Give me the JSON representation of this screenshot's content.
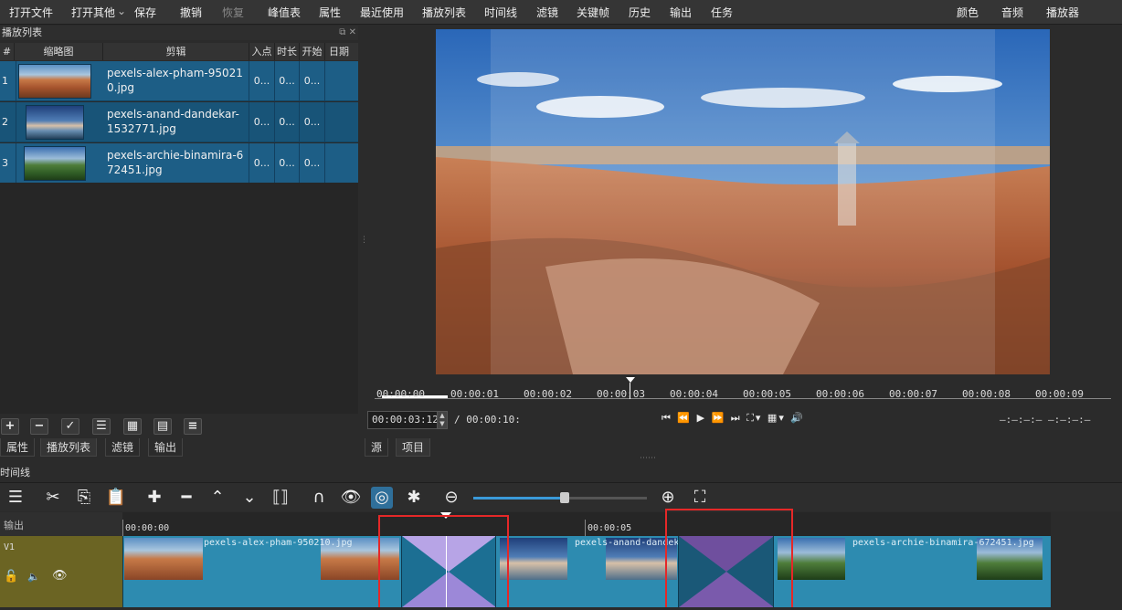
{
  "toolbar": {
    "items": [
      "打开文件",
      "打开其他",
      "保存",
      "撤销",
      "恢复",
      "峰值表",
      "属性",
      "最近使用",
      "播放列表",
      "时间线",
      "滤镜",
      "关键帧",
      "历史",
      "输出",
      "任务"
    ],
    "right_items": [
      "颜色",
      "音频",
      "播放器"
    ]
  },
  "playlist": {
    "title": "播放列表",
    "columns": [
      "#",
      "缩略图",
      "剪辑",
      "入点",
      "时长",
      "开始",
      "日期"
    ],
    "rows": [
      {
        "num": "1",
        "name": "pexels-alex-pham-950210.jpg",
        "in": "0...",
        "dur": "0...",
        "start": "0..."
      },
      {
        "num": "2",
        "name": "pexels-anand-dandekar-1532771.jpg",
        "in": "0...",
        "dur": "0...",
        "start": "0..."
      },
      {
        "num": "3",
        "name": "pexels-archie-binamira-672451.jpg",
        "in": "0...",
        "dur": "0...",
        "start": "0..."
      }
    ],
    "buttons": [
      "+",
      "−",
      "✓",
      "☰",
      "▦",
      "▤",
      "≡"
    ],
    "tabs": [
      "属性",
      "播放列表",
      "滤镜",
      "输出"
    ]
  },
  "viewer": {
    "ruler_ticks": [
      "00:00:00",
      "00:00:01",
      "00:00:02",
      "00:00:03",
      "00:00:04",
      "00:00:05",
      "00:00:06",
      "00:00:07",
      "00:00:08",
      "00:00:09"
    ],
    "timecode": "00:00:03:12",
    "duration": "/ 00:00:10:",
    "right_readout": "—:—:—:— —:—:—:—",
    "tabs": [
      "源",
      "项目"
    ]
  },
  "timeline": {
    "label": "时间线",
    "output_label": "输出",
    "track_label": "V1",
    "ruler": [
      "00:00:00",
      "00:00:05"
    ],
    "clips": [
      "pexels-alex-pham-950210.jpg",
      "pexels-anand-dandek",
      "pexels-archie-binamira-672451.jpg"
    ]
  },
  "colors": {
    "accent": "#1d5e86",
    "clip": "#2d8bb0",
    "track": "#6b6423",
    "highlight": "#e52828"
  }
}
